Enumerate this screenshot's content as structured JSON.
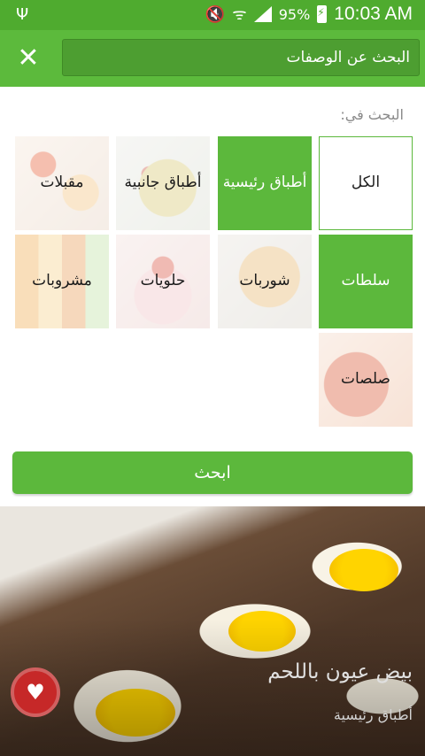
{
  "status_bar": {
    "usb_icon": "usb-icon",
    "battery_percent": "95%",
    "time": "10:03 AM"
  },
  "toolbar": {
    "close_icon": "close-icon",
    "search_value": "البحث عن الوصفات"
  },
  "search_in_label": "البحث في:",
  "categories": [
    {
      "label": "الكل",
      "state": "unselected"
    },
    {
      "label": "أطباق رئيسية",
      "state": "selected"
    },
    {
      "label": "أطباق جانبية",
      "state": "unselected"
    },
    {
      "label": "مقبلات",
      "state": "unselected"
    },
    {
      "label": "سلطات",
      "state": "selected"
    },
    {
      "label": "شوربات",
      "state": "unselected"
    },
    {
      "label": "حلويات",
      "state": "unselected"
    },
    {
      "label": "مشروبات",
      "state": "unselected"
    },
    {
      "label": "صلصات",
      "state": "unselected"
    }
  ],
  "search_button_label": "ابحث",
  "recipe_card": {
    "title": "بيض عيون باللحم",
    "category": "أطباق رئيسية",
    "favorite_icon": "heart-icon"
  },
  "colors": {
    "accent_green": "#5cb83c",
    "status_green": "#4fab2f",
    "favorite_red": "#c62828"
  }
}
